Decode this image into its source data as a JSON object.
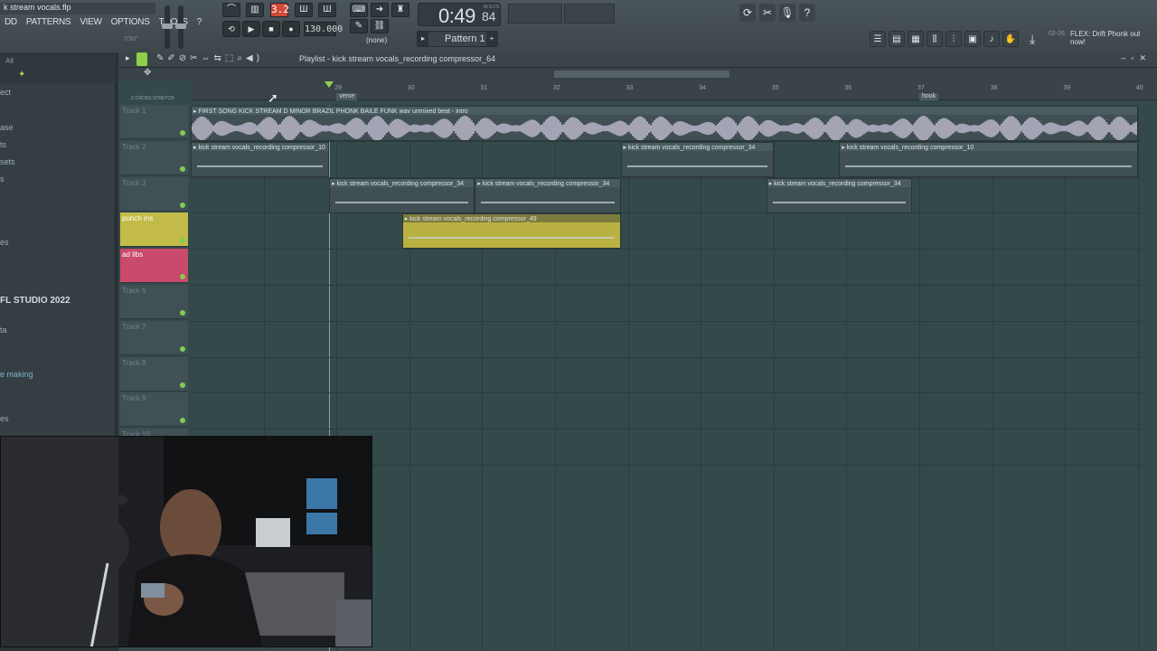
{
  "window": {
    "file_title": "k stream vocals.flp",
    "menu": [
      "DD",
      "PATTERNS",
      "VIEW",
      "OPTIONS",
      "TOOLS",
      "?"
    ],
    "menu_hint": "0'50\""
  },
  "transport": {
    "time": "0:49",
    "time_ms": "84",
    "time_label": "M:S:CS",
    "tempo": "130.000",
    "pattern_label": "Pattern 1",
    "pattern_sub": "(none)",
    "step_counter": "3.2"
  },
  "news": {
    "date": "02-26",
    "text": "FLEX: Drift Phonk out now!"
  },
  "browser": {
    "filter": "All",
    "items": [
      "ect",
      "ase",
      "ts",
      "sets",
      "s",
      "es",
      "ta",
      "e making",
      "es"
    ],
    "highlight": "FL STUDIO 2022"
  },
  "playlist": {
    "title": "Playlist - kick stream vocals_recording compressor_64",
    "crossfade_label": "Z-CROSS  STRETCH",
    "bar_numbers": [
      "29",
      "30",
      "31",
      "32",
      "33",
      "34",
      "35",
      "36",
      "37",
      "38",
      "39",
      "40"
    ],
    "markers": [
      {
        "label": "verse",
        "bar": 29
      },
      {
        "label": "hook",
        "bar": 37
      }
    ],
    "tracks": [
      {
        "name": "Track 1",
        "color": "#405055"
      },
      {
        "name": "Track 2",
        "color": "#405055"
      },
      {
        "name": "Track 3",
        "color": "#405055"
      },
      {
        "name": "punch ins",
        "color": "#c3bb48"
      },
      {
        "name": "ad libs",
        "color": "#c94a6a"
      },
      {
        "name": "Track 6",
        "color": "#405055"
      },
      {
        "name": "Track 7",
        "color": "#405055"
      },
      {
        "name": "Track 8",
        "color": "#405055"
      },
      {
        "name": "Track 9",
        "color": "#405055"
      },
      {
        "name": "Track 10",
        "color": "#405055"
      }
    ],
    "clips": [
      {
        "track": 1,
        "label": "FIRST SONG KICK STREAM D MINOR BRAZIL PHONK BAILE FUNK wav unmixed beat - intro",
        "start": 27.0,
        "end": 40.0
      },
      {
        "track": 2,
        "label": "kick stream vocals_recording compressor_10",
        "start": 27.0,
        "end": 28.9
      },
      {
        "track": 2,
        "label": "kick stream vocals_recording compressor_34",
        "start": 32.9,
        "end": 35.0
      },
      {
        "track": 2,
        "label": "kick stream vocals_recording compressor_10",
        "start": 35.9,
        "end": 40.0
      },
      {
        "track": 3,
        "label": "kick stream vocals_recording compressor_34",
        "start": 28.9,
        "end": 30.9
      },
      {
        "track": 3,
        "label": "kick stream vocals_recording compressor_34",
        "start": 30.9,
        "end": 32.9
      },
      {
        "track": 3,
        "label": "kick stream vocals_recording compressor_34",
        "start": 34.9,
        "end": 36.9
      },
      {
        "track": 4,
        "label": "kick stream vocals_recording compressor_49",
        "start": 29.9,
        "end": 32.9
      }
    ]
  },
  "webcam": {
    "description": "webcam overlay"
  }
}
